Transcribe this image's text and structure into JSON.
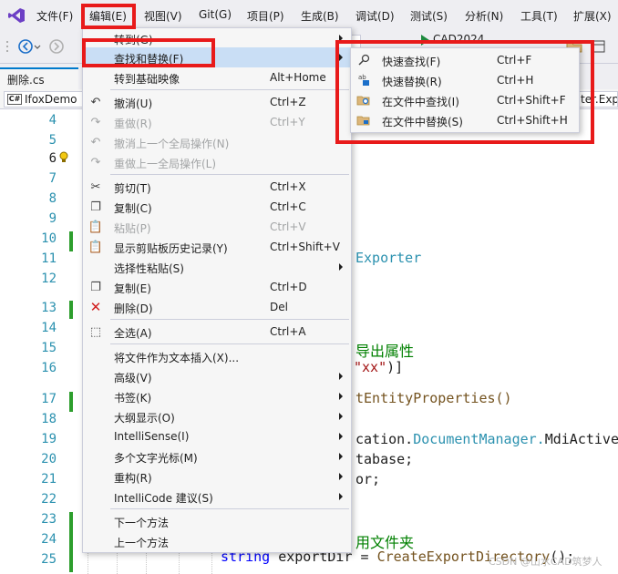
{
  "menubar": {
    "items": [
      {
        "label": "文件(F)"
      },
      {
        "label": "编辑(E)"
      },
      {
        "label": "视图(V)"
      },
      {
        "label": "Git(G)"
      },
      {
        "label": "项目(P)"
      },
      {
        "label": "生成(B)"
      },
      {
        "label": "调试(D)"
      },
      {
        "label": "测试(S)"
      },
      {
        "label": "分析(N)"
      },
      {
        "label": "工具(T)"
      },
      {
        "label": "扩展(X)"
      }
    ]
  },
  "toolbar": {
    "run_label": "CAD2024"
  },
  "tabs": {
    "document_tab": "删除.cs"
  },
  "navbar": {
    "project": "IfoxDemo",
    "cs_badge": "C#",
    "right_member": "ter.Exp"
  },
  "editor": {
    "line_numbers": [
      "4",
      "5",
      "6",
      "7",
      "8",
      "9",
      "10",
      "11",
      "12",
      "13",
      "14",
      "15",
      "16",
      "17",
      "18",
      "19",
      "20",
      "21",
      "22",
      "23",
      "24",
      "25"
    ],
    "current_line": "6",
    "code": {
      "l11": "Exporter",
      "l15": "导出属性",
      "l16_str": "\"xx\"",
      "l16_close": ")]",
      "l17": "tEntityProperties()",
      "l19_a": "cation.",
      "l19_b": "DocumentManager.",
      "l19_c": "MdiActive",
      "l20": "tabase;",
      "l21": "or;",
      "l24": "用文件夹",
      "l25_kw": "string",
      "l25_var": " exportDir = ",
      "l25_fn": "CreateExportDirectory",
      "l25_end": "();"
    }
  },
  "edit_menu": {
    "items": [
      {
        "label": "转到(G)",
        "shortcut": "",
        "submenu": true,
        "disabled": false
      },
      {
        "label": "查找和替换(F)",
        "shortcut": "",
        "submenu": true,
        "disabled": false
      },
      {
        "label": "转到基础映像",
        "shortcut": "Alt+Home",
        "submenu": false,
        "disabled": false
      },
      {
        "label": "撤消(U)",
        "shortcut": "Ctrl+Z",
        "submenu": false,
        "disabled": false
      },
      {
        "label": "重做(R)",
        "shortcut": "Ctrl+Y",
        "submenu": false,
        "disabled": true
      },
      {
        "label": "撤消上一个全局操作(N)",
        "shortcut": "",
        "submenu": false,
        "disabled": true
      },
      {
        "label": "重做上一全局操作(L)",
        "shortcut": "",
        "submenu": false,
        "disabled": true
      },
      {
        "label": "剪切(T)",
        "shortcut": "Ctrl+X",
        "submenu": false,
        "disabled": false
      },
      {
        "label": "复制(C)",
        "shortcut": "Ctrl+C",
        "submenu": false,
        "disabled": false
      },
      {
        "label": "粘贴(P)",
        "shortcut": "Ctrl+V",
        "submenu": false,
        "disabled": true
      },
      {
        "label": "显示剪贴板历史记录(Y)",
        "shortcut": "Ctrl+Shift+V",
        "submenu": false,
        "disabled": false
      },
      {
        "label": "选择性粘贴(S)",
        "shortcut": "",
        "submenu": true,
        "disabled": false
      },
      {
        "label": "复制(E)",
        "shortcut": "Ctrl+D",
        "submenu": false,
        "disabled": false
      },
      {
        "label": "删除(D)",
        "shortcut": "Del",
        "submenu": false,
        "disabled": false
      },
      {
        "label": "全选(A)",
        "shortcut": "Ctrl+A",
        "submenu": false,
        "disabled": false
      },
      {
        "label": "将文件作为文本插入(X)...",
        "shortcut": "",
        "submenu": false,
        "disabled": false
      },
      {
        "label": "高级(V)",
        "shortcut": "",
        "submenu": true,
        "disabled": false
      },
      {
        "label": "书签(K)",
        "shortcut": "",
        "submenu": true,
        "disabled": false
      },
      {
        "label": "大纲显示(O)",
        "shortcut": "",
        "submenu": true,
        "disabled": false
      },
      {
        "label": "IntelliSense(I)",
        "shortcut": "",
        "submenu": true,
        "disabled": false
      },
      {
        "label": "多个文字光标(M)",
        "shortcut": "",
        "submenu": true,
        "disabled": false
      },
      {
        "label": "重构(R)",
        "shortcut": "",
        "submenu": true,
        "disabled": false
      },
      {
        "label": "IntelliCode 建议(S)",
        "shortcut": "",
        "submenu": true,
        "disabled": false
      },
      {
        "label": "下一个方法",
        "shortcut": "",
        "submenu": false,
        "disabled": false
      },
      {
        "label": "上一个方法",
        "shortcut": "",
        "submenu": false,
        "disabled": false
      }
    ]
  },
  "find_submenu": {
    "items": [
      {
        "label": "快速查找(F)",
        "shortcut": "Ctrl+F"
      },
      {
        "label": "快速替换(R)",
        "shortcut": "Ctrl+H"
      },
      {
        "label": "在文件中查找(I)",
        "shortcut": "Ctrl+Shift+F"
      },
      {
        "label": "在文件中替换(S)",
        "shortcut": "Ctrl+Shift+H"
      }
    ]
  },
  "watermark": "CSDN @山水CAD筑梦人",
  "colors": {
    "annotation_red": "#e81a1a",
    "highlight": "#c9def5",
    "menu_bg": "#f6f6f6",
    "chrome_bg": "#eeeef2"
  }
}
